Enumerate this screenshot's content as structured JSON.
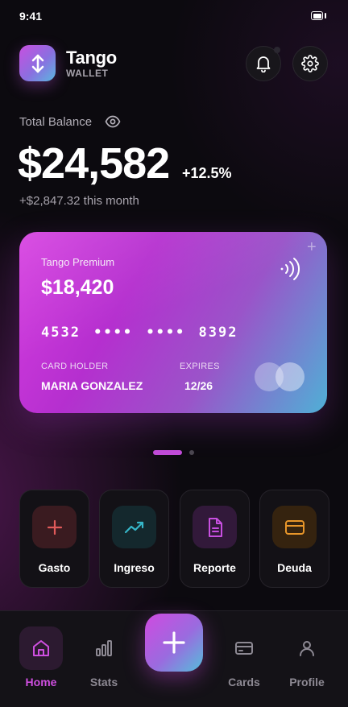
{
  "status_bar": {
    "time": "9:41",
    "battery_icon": "battery-icon"
  },
  "header": {
    "brand": "Tango",
    "brand_sub": "WALLET",
    "logo_icon": "swap-vertical-icon",
    "bell_icon": "bell-icon",
    "settings_icon": "gear-icon"
  },
  "balance": {
    "label": "Total Balance",
    "visibility_icon": "eye-icon",
    "value": "$24,582",
    "change": "+12.5%",
    "month_delta": "+$2,847.32 this month"
  },
  "card": {
    "tier": "Tango Premium",
    "amount": "$18,420",
    "number": "4532 •••• •••• 8392",
    "holder_label": "CARD HOLDER",
    "holder_name": "MARIA GONZALEZ",
    "expires_label": "EXPIRES",
    "expires_value": "12/26",
    "plus": "+",
    "contactless_icon": "contactless-icon",
    "network_icon": "card-network-logo"
  },
  "pagination": {
    "total": 2,
    "active": 1
  },
  "quick_actions": [
    {
      "label": "Gasto",
      "icon": "plus-icon",
      "color": "#e05a5a",
      "bg": "#3a1b20"
    },
    {
      "label": "Ingreso",
      "icon": "trending-up-icon",
      "color": "#36b7c9",
      "bg": "#14282d"
    },
    {
      "label": "Reporte",
      "icon": "document-icon",
      "color": "#c84fe0",
      "bg": "#32193a"
    },
    {
      "label": "Deuda",
      "icon": "credit-card-icon",
      "color": "#e8962a",
      "bg": "#35230f"
    }
  ],
  "nav": {
    "items": [
      {
        "label": "Home",
        "icon": "home-icon",
        "active": true
      },
      {
        "label": "Stats",
        "icon": "bar-chart-icon",
        "active": false
      },
      {
        "label": "Cards",
        "icon": "wallet-card-icon",
        "active": false
      },
      {
        "label": "Profile",
        "icon": "user-icon",
        "active": false
      }
    ],
    "fab_icon": "plus-icon"
  },
  "colors": {
    "accent": "#cf4fe0",
    "background": "#0c0a0f",
    "card_gradient_start": "#d63ce0",
    "card_gradient_end": "#4fb0d6"
  }
}
